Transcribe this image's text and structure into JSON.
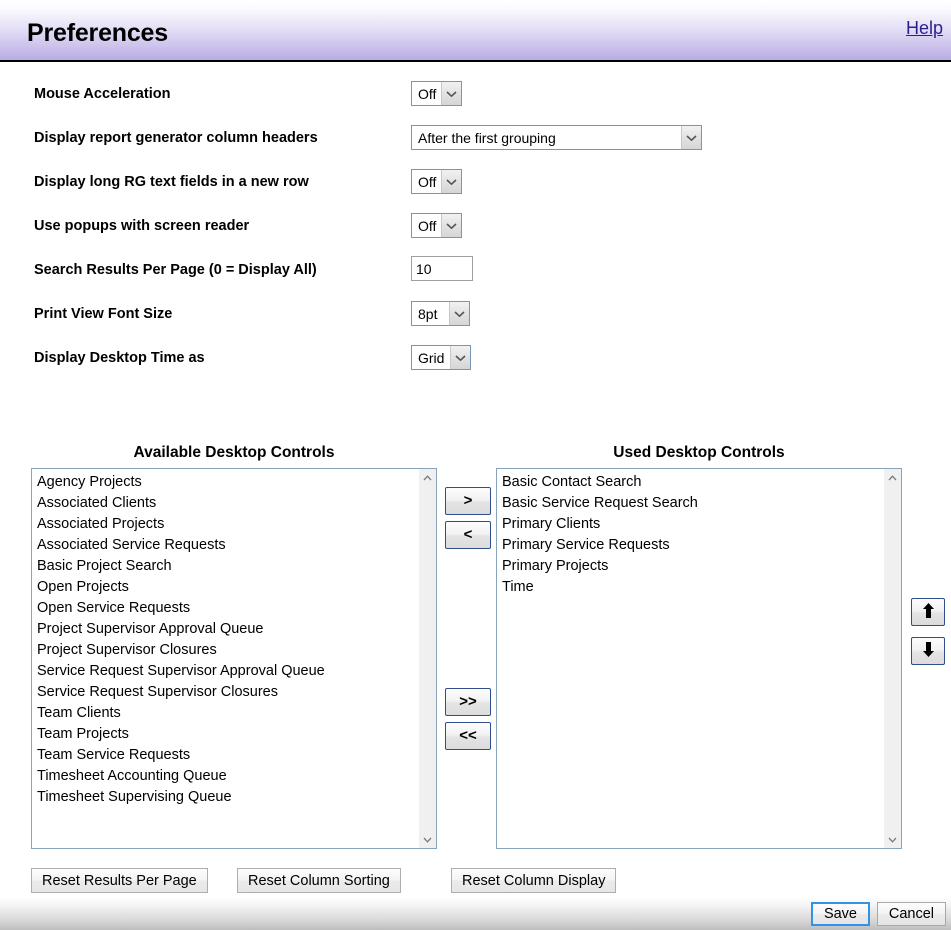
{
  "header": {
    "title": "Preferences",
    "help_label": "Help",
    "accent_color": "#b9abe4",
    "link_color": "#2a1f8f"
  },
  "form": {
    "rows": [
      {
        "label": "Mouse Acceleration",
        "control": "select",
        "value": "Off",
        "name": "mouse-acceleration"
      },
      {
        "label": "Display report generator column headers",
        "control": "select",
        "value": "After the first grouping",
        "name": "report-generator-column-headers"
      },
      {
        "label": "Display long RG text fields in a new row",
        "control": "select",
        "value": "Off",
        "name": "long-rg-text-fields-new-row"
      },
      {
        "label": "Use popups with screen reader",
        "control": "select",
        "value": "Off",
        "name": "popups-with-screen-reader"
      },
      {
        "label": "Search Results Per Page (0 = Display All)",
        "control": "text",
        "value": "10",
        "name": "search-results-per-page"
      },
      {
        "label": "Print View Font Size",
        "control": "select",
        "value": "8pt",
        "name": "print-view-font-size"
      },
      {
        "label": "Display Desktop Time as",
        "control": "select",
        "value": "Grid",
        "name": "display-desktop-time-as"
      }
    ]
  },
  "lists": {
    "available": {
      "header": "Available Desktop Controls",
      "items": [
        "Agency Projects",
        "Associated Clients",
        "Associated Projects",
        "Associated Service Requests",
        "Basic Project Search",
        "Open Projects",
        "Open Service Requests",
        "Project Supervisor Approval Queue",
        "Project Supervisor Closures",
        "Service Request Supervisor Approval Queue",
        "Service Request Supervisor Closures",
        "Team Clients",
        "Team Projects",
        "Team Service Requests",
        "Timesheet Accounting Queue",
        "Timesheet Supervising Queue"
      ]
    },
    "used": {
      "header": "Used Desktop Controls",
      "items": [
        "Basic Contact Search",
        "Basic Service Request Search",
        "Primary Clients",
        "Primary Service Requests",
        "Primary Projects",
        "Time"
      ]
    }
  },
  "transfer_buttons": {
    "add": ">",
    "remove": "<",
    "add_all": ">>",
    "remove_all": "<<"
  },
  "reorder_buttons": {
    "move_up": "move-up-arrow-icon",
    "move_down": "move-down-arrow-icon"
  },
  "reset_buttons": [
    {
      "label": "Reset Results Per Page",
      "name": "reset-results-per-page"
    },
    {
      "label": "Reset Column Sorting",
      "name": "reset-column-sorting"
    },
    {
      "label": "Reset Column Display",
      "name": "reset-column-display"
    }
  ],
  "footer": {
    "save_label": "Save",
    "cancel_label": "Cancel",
    "focus_color": "#2f94e8"
  }
}
